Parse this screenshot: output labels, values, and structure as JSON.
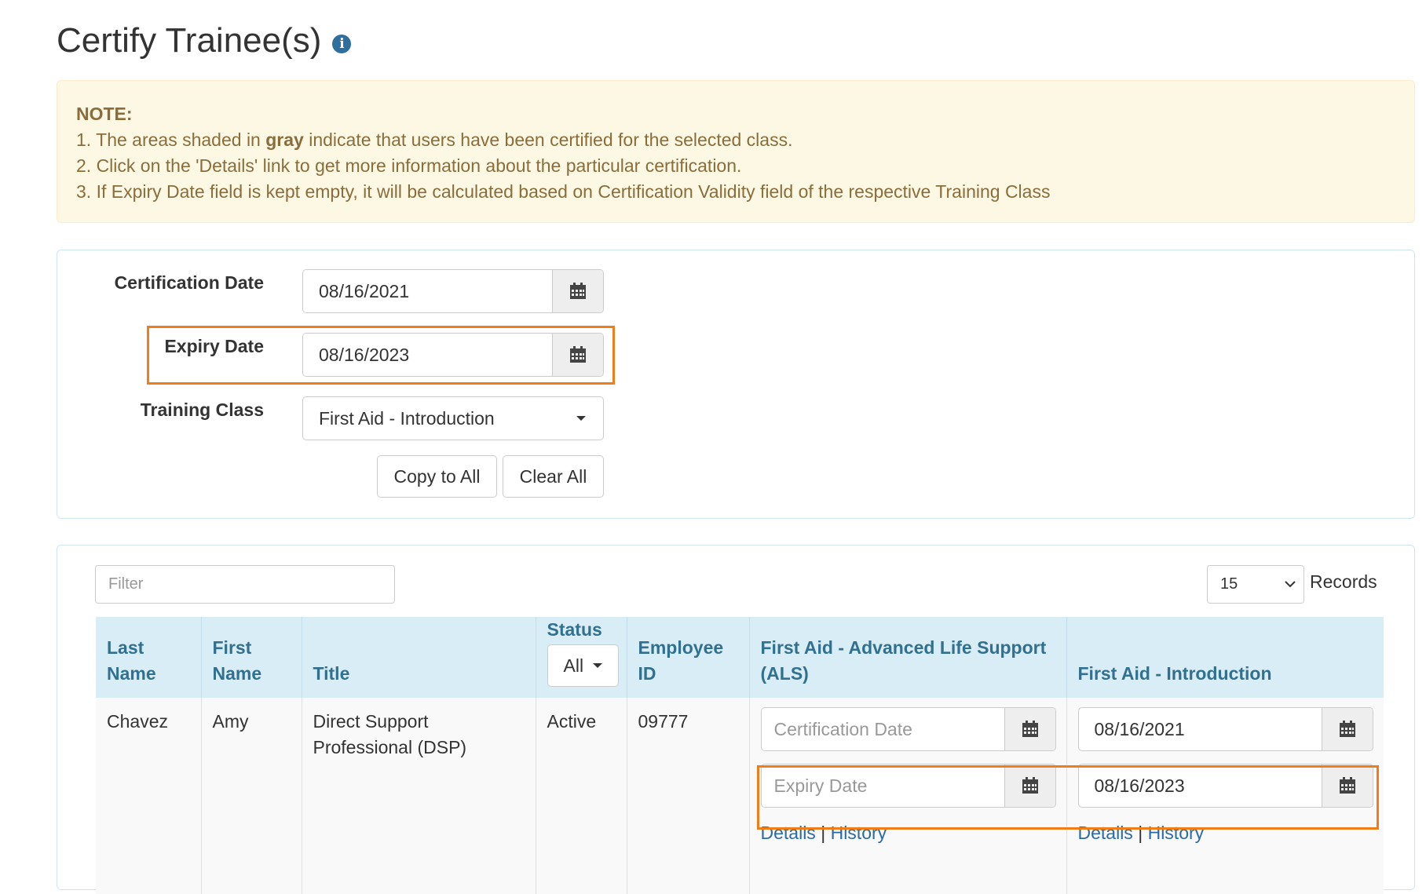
{
  "page": {
    "title": "Certify Trainee(s)",
    "info_icon": "info-circle-icon"
  },
  "note": {
    "title": "NOTE:",
    "line1_prefix": "1. The areas shaded in ",
    "line1_bold": "gray",
    "line1_suffix": " indicate that users have been certified for the selected class.",
    "line2": "2. Click on the 'Details' link to get more information about the particular certification.",
    "line3": "3. If Expiry Date field is kept empty, it will be calculated based on Certification Validity field of the respective Training Class"
  },
  "form": {
    "certification_date_label": "Certification Date",
    "certification_date_value": "08/16/2021",
    "expiry_date_label": "Expiry Date",
    "expiry_date_value": "08/16/2023",
    "training_class_label": "Training Class",
    "training_class_value": "First Aid - Introduction",
    "copy_to_all": "Copy to All",
    "clear_all": "Clear All",
    "calendar_icon": "calendar-icon"
  },
  "list": {
    "filter_placeholder": "Filter",
    "records_value": "15",
    "records_label": "Records",
    "columns": {
      "last_name": "Last Name",
      "first_name": "First Name",
      "title": "Title",
      "status": "Status",
      "status_filter": "All",
      "employee_id": "Employee ID",
      "class1": "First Aid - Advanced Life Support (ALS)",
      "class2": "First Aid - Introduction"
    },
    "rows": [
      {
        "last_name": "Chavez",
        "first_name": "Amy",
        "title": "Direct Support Professional (DSP)",
        "status": "Active",
        "employee_id": "09777",
        "class1": {
          "cert_placeholder": "Certification Date",
          "expiry_placeholder": "Expiry Date",
          "details": "Details",
          "separator": "|",
          "history": "History"
        },
        "class2": {
          "cert_value": "08/16/2021",
          "expiry_value": "08/16/2023",
          "details": "Details",
          "separator": "|",
          "history": "History"
        }
      }
    ]
  },
  "colors": {
    "highlight": "#ef7d1a",
    "header_bg": "#d9edf7",
    "header_text": "#31708f",
    "note_bg": "#fcf8e3",
    "note_text": "#8a6d3b",
    "link": "#2a6aa6"
  }
}
